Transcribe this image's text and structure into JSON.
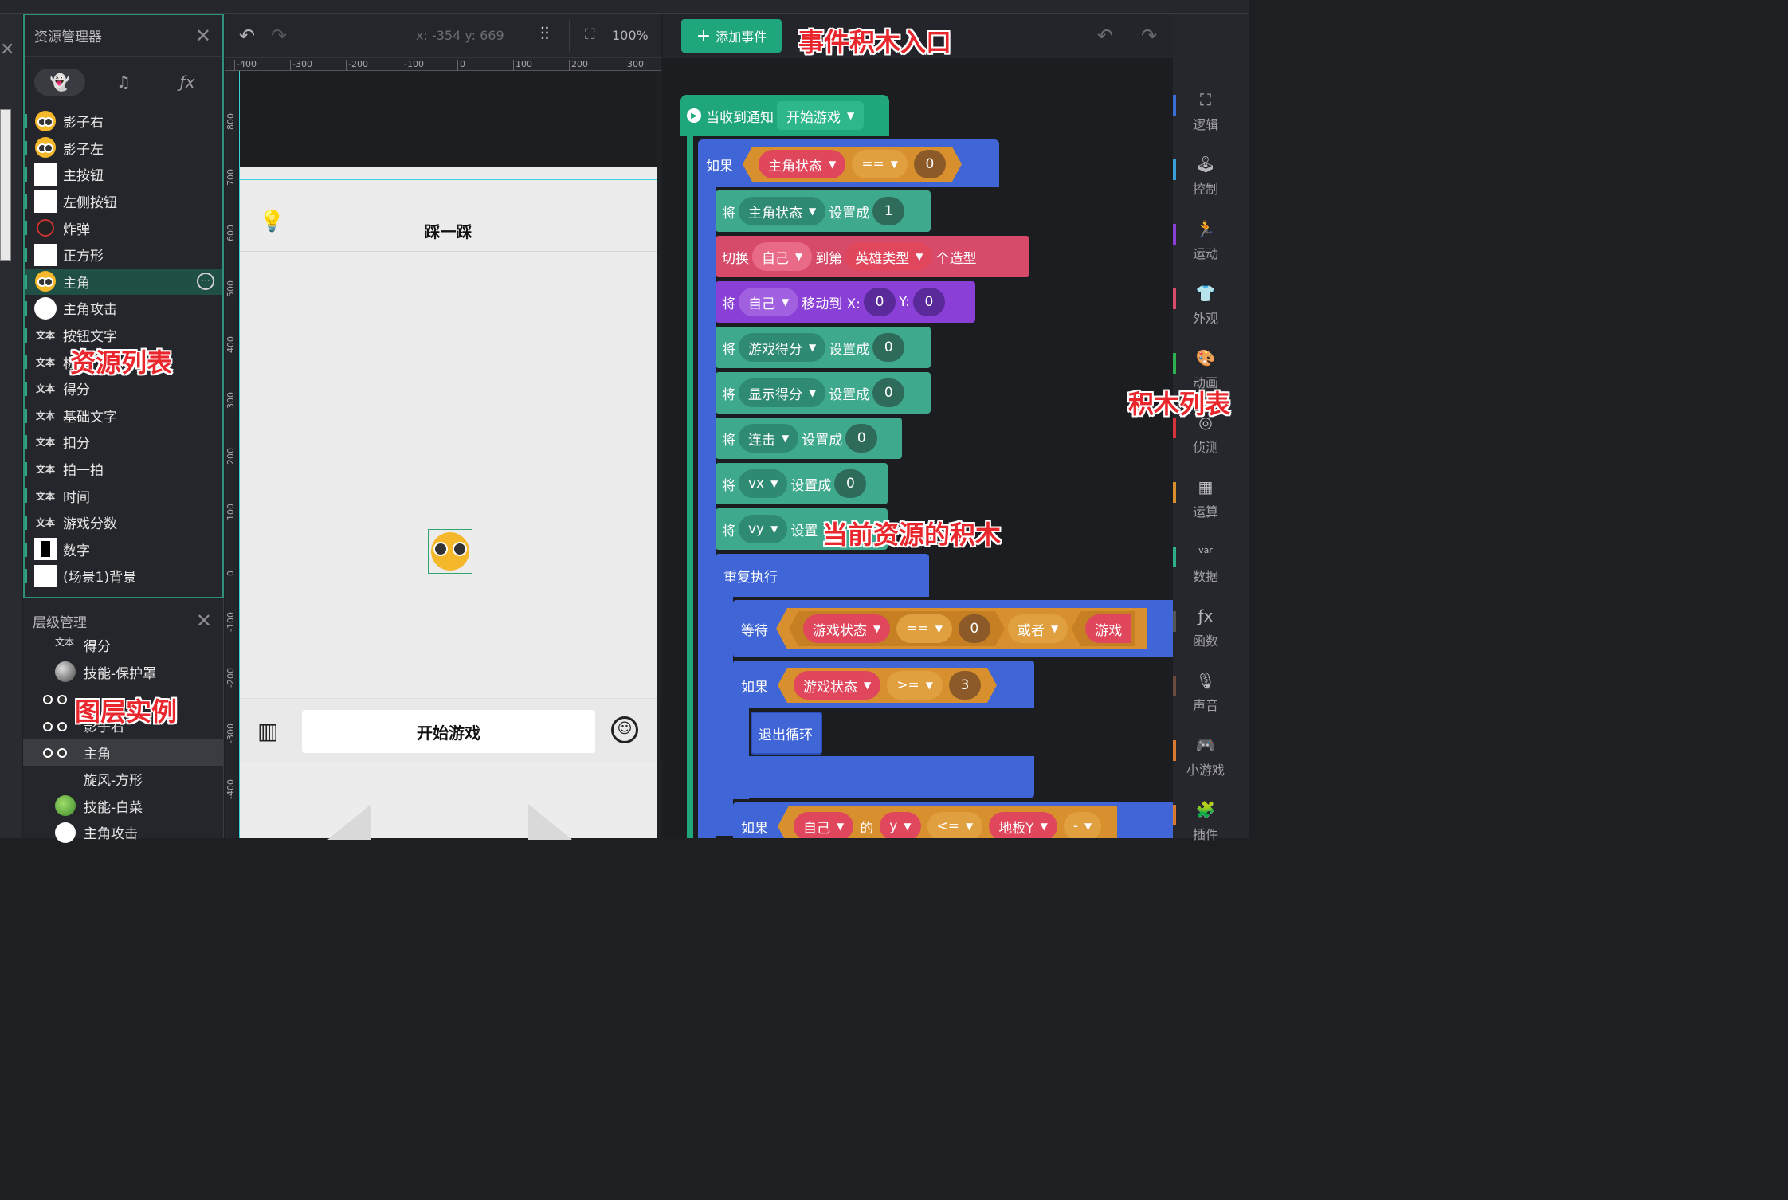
{
  "resource_panel": {
    "title": "资源管理器",
    "tabs": [
      "ghost-icon",
      "music-icon",
      "fx"
    ],
    "items": [
      {
        "label": "影子右",
        "thumb": "face"
      },
      {
        "label": "影子左",
        "thumb": "face"
      },
      {
        "label": "主按钮",
        "thumb": "white"
      },
      {
        "label": "左侧按钮",
        "thumb": "white"
      },
      {
        "label": "炸弹",
        "thumb": "bomb"
      },
      {
        "label": "正方形",
        "thumb": "white"
      },
      {
        "label": "主角",
        "thumb": "face"
      },
      {
        "label": "主角攻击",
        "thumb": "circle"
      },
      {
        "label": "按钮文字",
        "thumb": "text"
      },
      {
        "label": "标",
        "thumb": "text"
      },
      {
        "label": "得分",
        "thumb": "text"
      },
      {
        "label": "基础文字",
        "thumb": "text"
      },
      {
        "label": "扣分",
        "thumb": "text"
      },
      {
        "label": "拍一拍",
        "thumb": "text"
      },
      {
        "label": "时间",
        "thumb": "text"
      },
      {
        "label": "游戏分数",
        "thumb": "text"
      },
      {
        "label": "数字",
        "thumb": "black"
      },
      {
        "label": "(场景1)背景",
        "thumb": "white"
      }
    ],
    "text_thumb_label": "文本"
  },
  "layer_panel": {
    "title": "层级管理",
    "items": [
      {
        "label": "得分",
        "thumb": "text"
      },
      {
        "label": "技能-保护罩",
        "thumb": "orb"
      },
      {
        "label": "",
        "thumb": "face"
      },
      {
        "label": "影子右",
        "thumb": "face"
      },
      {
        "label": "主角",
        "thumb": "face"
      },
      {
        "label": "旋风-方形",
        "thumb": "none"
      },
      {
        "label": "技能-白菜",
        "thumb": "cabbage"
      },
      {
        "label": "主角攻击",
        "thumb": "circle"
      }
    ]
  },
  "stage_toolbar": {
    "coord": "x: -354  y: 669",
    "zoom": "100%"
  },
  "ruler": {
    "h": [
      "-400",
      "-300",
      "-200",
      "-100",
      "0",
      "100",
      "200",
      "300"
    ],
    "v": [
      "800",
      "700",
      "600",
      "500",
      "400",
      "300",
      "200",
      "100",
      "0",
      "-100",
      "-200",
      "-300",
      "-400"
    ]
  },
  "stage": {
    "game_title": "踩一踩",
    "start_button": "开始游戏"
  },
  "workspace": {
    "add_event_label": "添加事件",
    "blocks": {
      "event_label": "当收到通知",
      "event_value": "开始游戏",
      "if1": "如果",
      "if1_var": "主角状态",
      "eq": "==",
      "zero": "0",
      "set": "将",
      "set_to": "设置成",
      "one": "1",
      "switch": "切换",
      "self": "自己",
      "to_nth": "到第",
      "hero_type": "英雄类型",
      "costume": "个造型",
      "move_to": "移动到 X:",
      "y_label": "Y:",
      "game_score": "游戏得分",
      "show_score": "显示得分",
      "combo": "连击",
      "vx": "vx",
      "vy": "vy",
      "set_trunc": "设置",
      "repeat": "重复执行",
      "wait": "等待",
      "game_state": "游戏状态",
      "or": "或者",
      "game_state_trunc": "游戏",
      "gte": ">=",
      "three": "3",
      "break": "退出循环",
      "of": "的",
      "y": "y",
      "lte": "<=",
      "floor_y": "地板Y",
      "minus": "-"
    }
  },
  "palette": [
    {
      "label": "逻辑",
      "color": "#3b6fd8",
      "icon": "sitemap-icon"
    },
    {
      "label": "控制",
      "color": "#3aa0d8",
      "icon": "joystick-icon"
    },
    {
      "label": "运动",
      "color": "#8a3fd6",
      "icon": "runner-icon"
    },
    {
      "label": "外观",
      "color": "#d84a6a",
      "icon": "shirt-icon"
    },
    {
      "label": "动画",
      "color": "#2fb04e",
      "icon": "palette-icon"
    },
    {
      "label": "侦测",
      "color": "#d8333a",
      "icon": "detect-icon"
    },
    {
      "label": "运算",
      "color": "#d8902f",
      "icon": "calculator-icon"
    },
    {
      "label": "数据",
      "color": "#2fae8a",
      "icon": "var-icon"
    },
    {
      "label": "函数",
      "color": "#555",
      "icon": "fx-icon"
    },
    {
      "label": "声音",
      "color": "#6b4a3f",
      "icon": "mic-icon"
    },
    {
      "label": "小游戏",
      "color": "#d87a2f",
      "icon": "gamepad-icon"
    },
    {
      "label": "插件",
      "color": "#d87a2f",
      "icon": "puzzle-icon"
    }
  ],
  "annotations": {
    "event_entry": "事件积木入口",
    "resource_list": "资源列表",
    "layer_instance": "图层实例",
    "current_blocks": "当前资源的积木",
    "block_list": "积木列表"
  },
  "colors": {
    "accent": "#20a67d",
    "event_block": "#20a67d",
    "logic_block": "#3f65d6",
    "operator_block": "#d8902f",
    "variable_block": "#3fa98d",
    "looks_block": "#d84a6a",
    "motion_block": "#8a3fd6"
  }
}
